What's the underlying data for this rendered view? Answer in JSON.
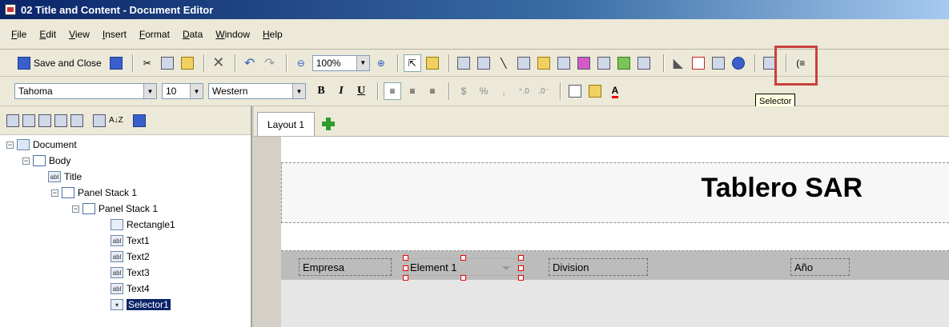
{
  "window": {
    "title": "02 Title and Content - Document Editor"
  },
  "menu": [
    "File",
    "Edit",
    "View",
    "Insert",
    "Format",
    "Data",
    "Window",
    "Help"
  ],
  "toolbar1": {
    "save_close_label": "Save and Close",
    "zoom_value": "100%"
  },
  "toolbar2": {
    "font_name": "Tahoma",
    "font_size": "10",
    "charset": "Western",
    "bold": "B",
    "italic": "I",
    "underline": "U",
    "currency": "$",
    "percent": "%",
    "comma": ","
  },
  "tooltip": {
    "text": "Selector"
  },
  "tree": {
    "nodes": [
      {
        "label": "Document"
      },
      {
        "label": "Body"
      },
      {
        "label": "Title"
      },
      {
        "label": "Panel Stack 1"
      },
      {
        "label": "Panel Stack 1"
      },
      {
        "label": "Rectangle1"
      },
      {
        "label": "Text1"
      },
      {
        "label": "Text2"
      },
      {
        "label": "Text3"
      },
      {
        "label": "Text4"
      },
      {
        "label": "Selector1"
      }
    ]
  },
  "layout": {
    "tab_label": "Layout 1",
    "title_text": "Tablero SAR",
    "fields": {
      "empresa": "Empresa",
      "element": "Element 1",
      "division": "Division",
      "anio": "Año"
    }
  },
  "colors": {
    "highlight": "#c9413a",
    "selection": "#0a246a",
    "handle": "#ee0000"
  }
}
